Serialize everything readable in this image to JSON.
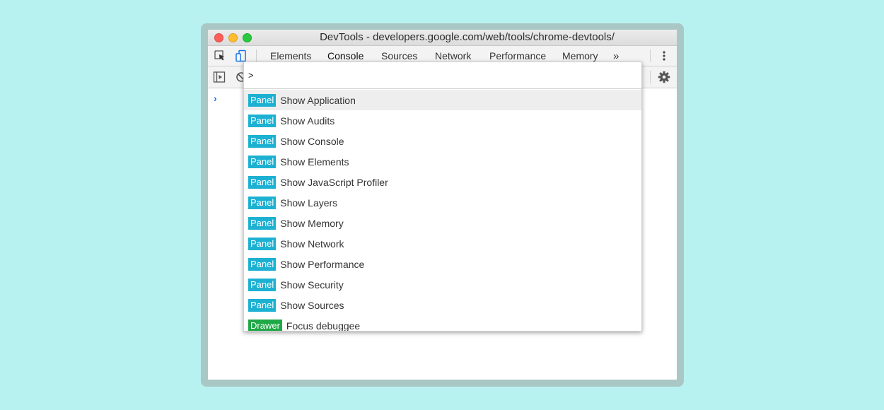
{
  "window": {
    "title": "DevTools - developers.google.com/web/tools/chrome-devtools/"
  },
  "tabs": [
    {
      "label": "Elements",
      "active": false
    },
    {
      "label": "Console",
      "active": true
    },
    {
      "label": "Sources",
      "active": false
    },
    {
      "label": "Network",
      "active": false
    },
    {
      "label": "Performance",
      "active": false
    },
    {
      "label": "Memory",
      "active": false
    }
  ],
  "more_tabs_label": "»",
  "command_menu": {
    "input_value": ">",
    "items": [
      {
        "badge": "Panel",
        "label": "Show Application",
        "selected": true
      },
      {
        "badge": "Panel",
        "label": "Show Audits",
        "selected": false
      },
      {
        "badge": "Panel",
        "label": "Show Console",
        "selected": false
      },
      {
        "badge": "Panel",
        "label": "Show Elements",
        "selected": false
      },
      {
        "badge": "Panel",
        "label": "Show JavaScript Profiler",
        "selected": false
      },
      {
        "badge": "Panel",
        "label": "Show Layers",
        "selected": false
      },
      {
        "badge": "Panel",
        "label": "Show Memory",
        "selected": false
      },
      {
        "badge": "Panel",
        "label": "Show Network",
        "selected": false
      },
      {
        "badge": "Panel",
        "label": "Show Performance",
        "selected": false
      },
      {
        "badge": "Panel",
        "label": "Show Security",
        "selected": false
      },
      {
        "badge": "Panel",
        "label": "Show Sources",
        "selected": false
      },
      {
        "badge": "Drawer",
        "label": "Focus debuggee",
        "selected": false
      }
    ]
  },
  "console": {
    "prompt_glyph": "›"
  },
  "colors": {
    "background": "#b8f2f0",
    "frame": "#a9c7c5",
    "panel_badge": "#1cb1d2",
    "drawer_badge": "#1fa846",
    "accent_blue": "#1a73e8"
  },
  "icons": {
    "inspect": "inspect-element-icon",
    "device": "device-toolbar-icon",
    "more": "kebab-menu-icon",
    "drawer": "show-drawer-icon",
    "clear": "clear-console-icon",
    "settings": "gear-icon"
  }
}
